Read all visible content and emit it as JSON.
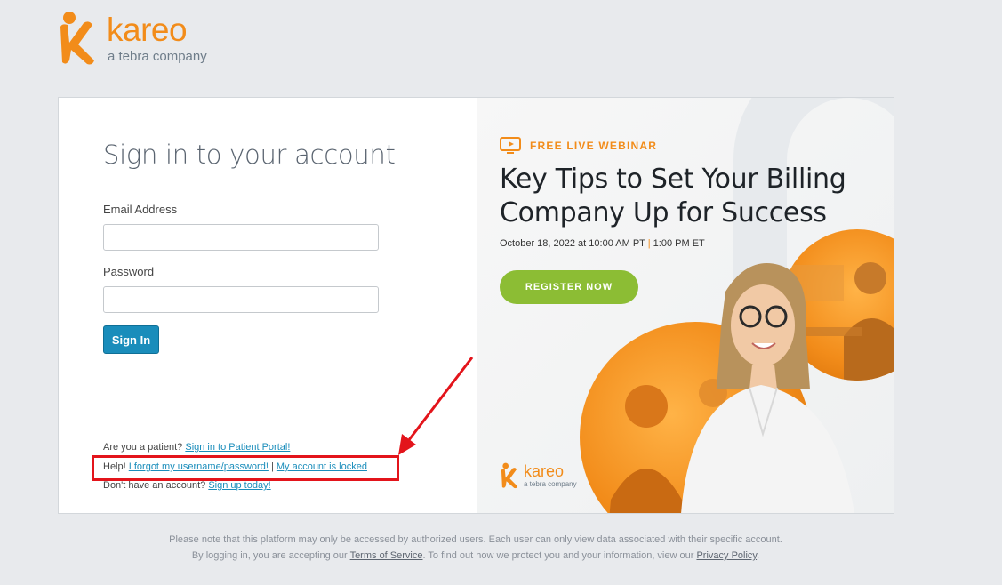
{
  "brand": {
    "name": "kareo",
    "tagline": "a tebra company",
    "accent": "#f28c1a"
  },
  "login": {
    "title": "Sign in to your account",
    "email_label": "Email Address",
    "email_value": "",
    "password_label": "Password",
    "password_value": "",
    "signin_label": "Sign In",
    "patient_prefix": "Are you a patient?",
    "patient_link": "Sign in to Patient Portal!",
    "help_prefix": "Help!",
    "forgot_link": "I forgot my username/password!",
    "help_separator": "|",
    "locked_link": "My account is locked",
    "signup_prefix": "Don't have an account?",
    "signup_link": "Sign up today!"
  },
  "promo": {
    "tag": "FREE LIVE WEBINAR",
    "headline": "Key Tips to Set Your Billing Company Up for Success",
    "date_part1": "October 18, 2022 at 10:00 AM PT",
    "date_separator": "|",
    "date_part2": "1:00 PM ET",
    "register_label": "REGISTER NOW",
    "logo_name": "kareo",
    "logo_tagline": "a tebra company"
  },
  "footer": {
    "line1": "Please note that this platform may only be accessed by authorized users. Each user can only view data associated with their specific account.",
    "line2_prefix": "By logging in, you are accepting our",
    "terms_link": "Terms of Service",
    "line2_middle": ". To find out how we protect you and your information, view our",
    "privacy_link": "Privacy Policy",
    "line2_suffix": "."
  },
  "annotation": {
    "color": "#e3141b"
  }
}
